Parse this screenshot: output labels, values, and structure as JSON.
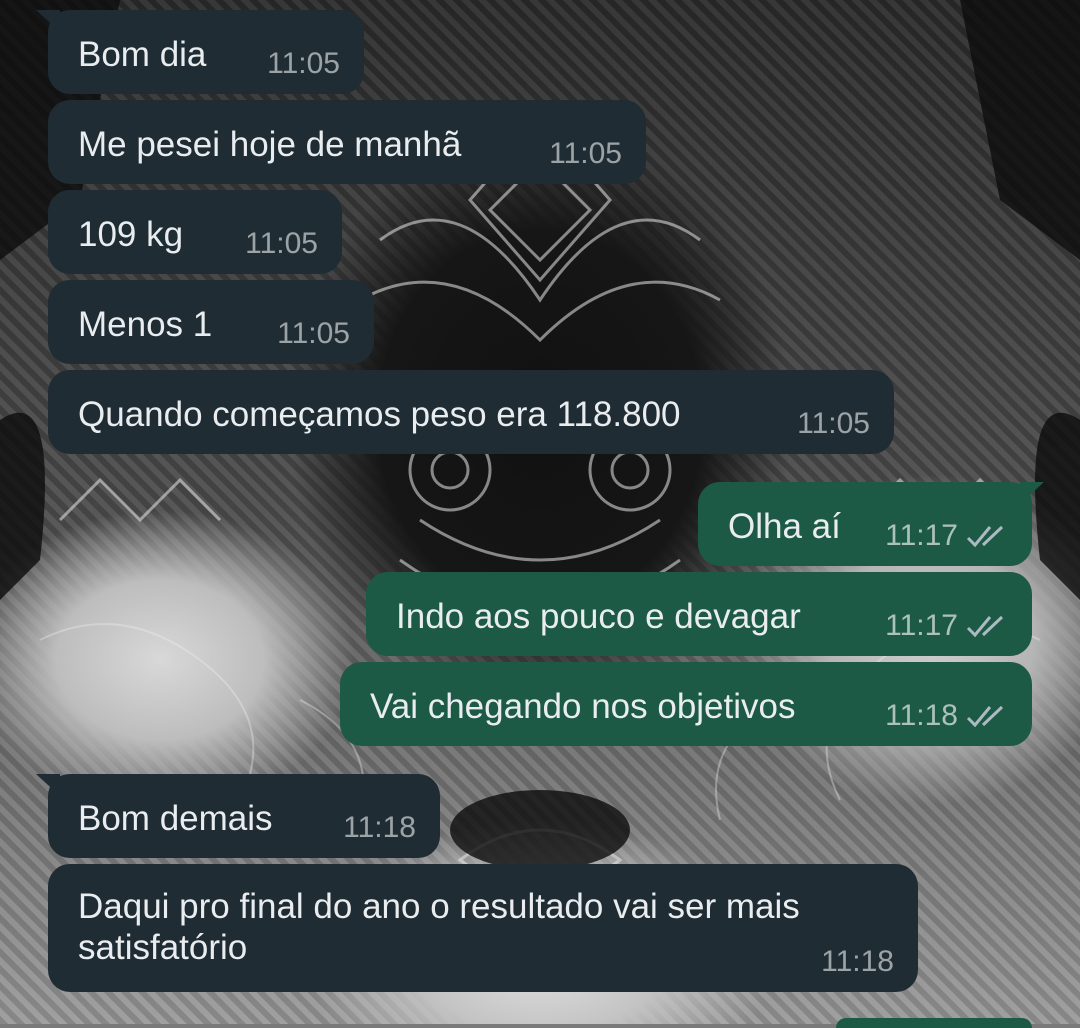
{
  "colors": {
    "incoming_bubble": "#202c33",
    "outgoing_bubble": "#1d5a45",
    "text": "#e9edef"
  },
  "messages": [
    {
      "direction": "in",
      "text": "Bom dia",
      "time": "11:05"
    },
    {
      "direction": "in",
      "text": "Me pesei hoje de manhã",
      "time": "11:05"
    },
    {
      "direction": "in",
      "text": "109 kg",
      "time": "11:05"
    },
    {
      "direction": "in",
      "text": "Menos 1",
      "time": "11:05"
    },
    {
      "direction": "in",
      "text": "Quando começamos peso era 118.800",
      "time": "11:05"
    },
    {
      "direction": "out",
      "text": "Olha aí",
      "time": "11:17",
      "status_icon": "double-check-icon"
    },
    {
      "direction": "out",
      "text": "Indo aos pouco e devagar",
      "time": "11:17",
      "status_icon": "double-check-icon"
    },
    {
      "direction": "out",
      "text": "Vai chegando nos objetivos",
      "time": "11:18",
      "status_icon": "double-check-icon"
    },
    {
      "direction": "in",
      "text": "Bom demais",
      "time": "11:18"
    },
    {
      "direction": "in",
      "text": "Daqui pro final do ano o resultado vai ser mais satisfatório",
      "time": "11:18"
    }
  ]
}
